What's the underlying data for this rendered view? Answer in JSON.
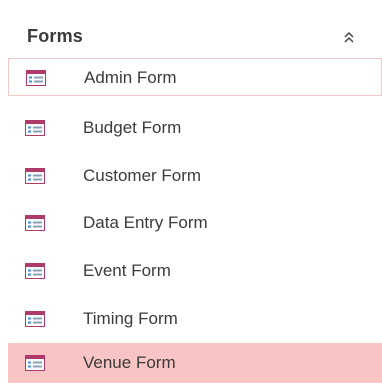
{
  "nav_group": {
    "title": "Forms",
    "collapse_icon": "double-chevron-up-icon"
  },
  "items": [
    {
      "label": "Admin Form",
      "icon": "form-icon",
      "state": "focused"
    },
    {
      "label": "Budget Form",
      "icon": "form-icon",
      "state": "normal"
    },
    {
      "label": "Customer Form",
      "icon": "form-icon",
      "state": "normal"
    },
    {
      "label": "Data Entry Form",
      "icon": "form-icon",
      "state": "normal"
    },
    {
      "label": "Event Form",
      "icon": "form-icon",
      "state": "normal"
    },
    {
      "label": "Timing Form",
      "icon": "form-icon",
      "state": "normal"
    },
    {
      "label": "Venue Form",
      "icon": "form-icon",
      "state": "selected"
    }
  ],
  "colors": {
    "selected_background": "#f9c4c4",
    "focus_border": "#f0c8c8",
    "icon_accent": "#b03a6a",
    "text": "#3b3b3b"
  }
}
